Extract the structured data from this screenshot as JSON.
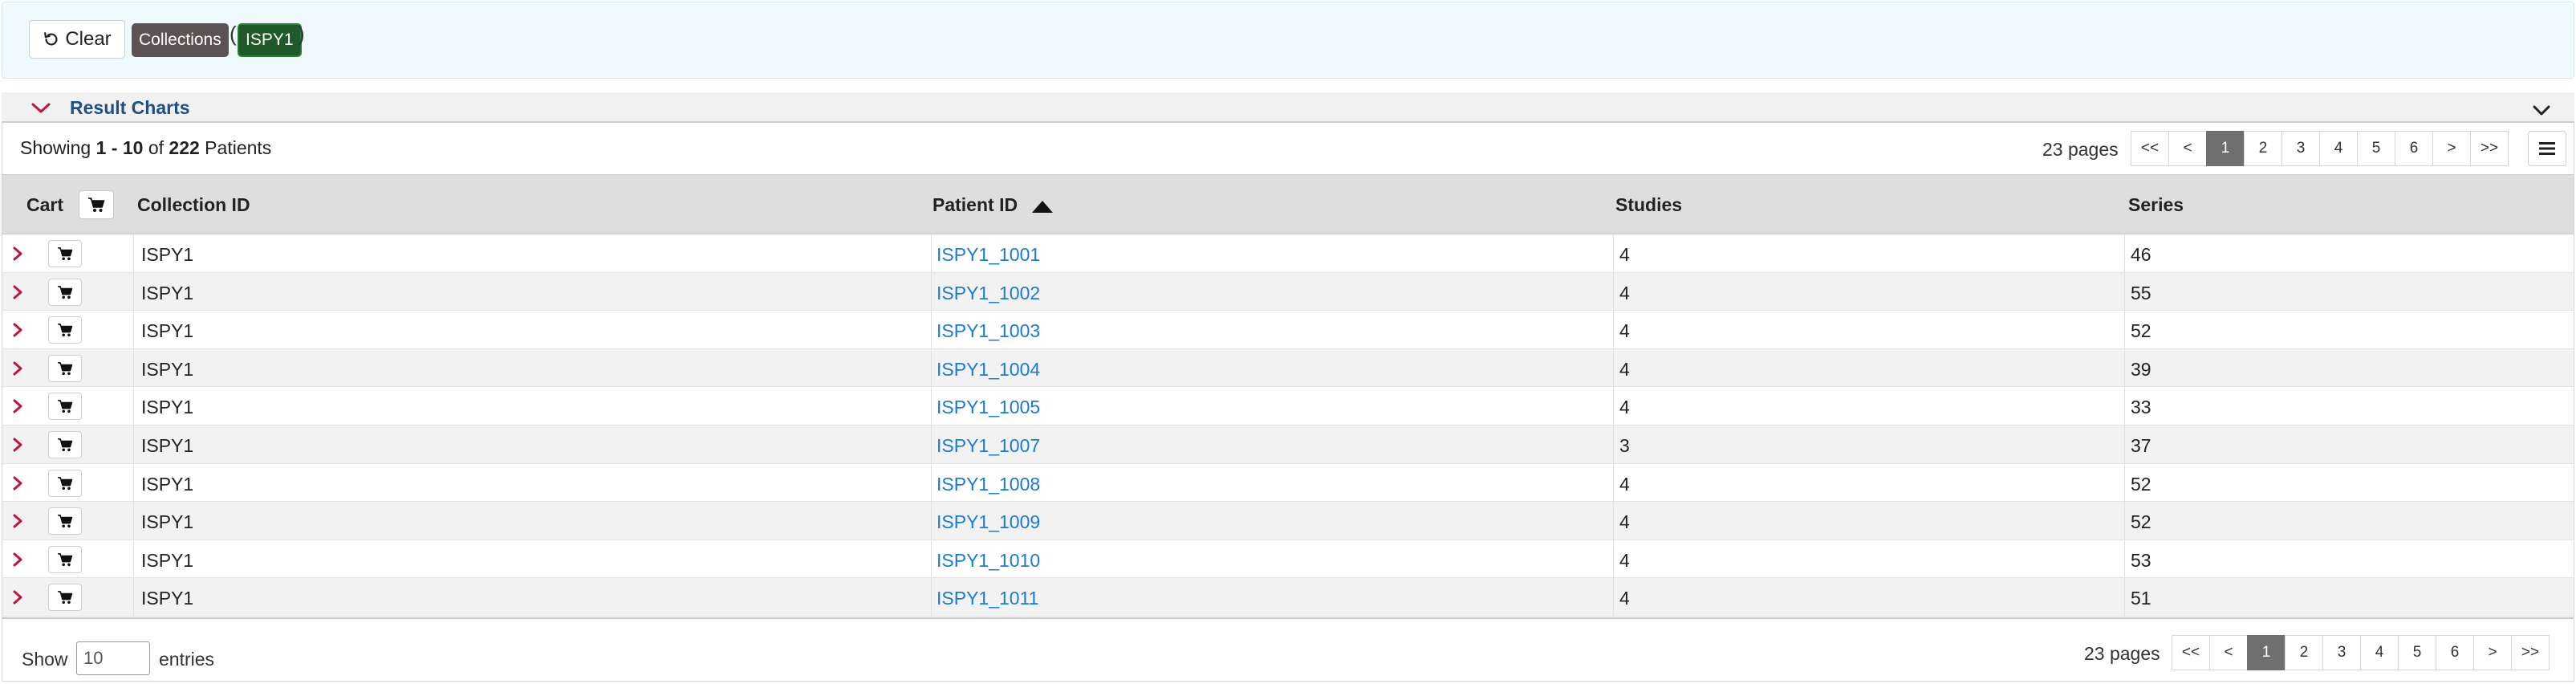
{
  "filter": {
    "clear_label": "Clear",
    "field_label": "Collections",
    "open_paren": "(",
    "value": "ISPY1",
    "close_paren": ")"
  },
  "charts": {
    "title": "Result Charts"
  },
  "summary": {
    "prefix": "Showing ",
    "range": "1 - 10",
    "of": " of ",
    "total": "222",
    "suffix": " Patients"
  },
  "pagination": {
    "pages_text": "23 pages",
    "first": "<<",
    "prev": "<",
    "pages": [
      "1",
      "2",
      "3",
      "4",
      "5",
      "6"
    ],
    "current_page": "1",
    "next": ">",
    "last": ">>"
  },
  "table": {
    "headers": {
      "cart": "Cart",
      "collection": "Collection ID",
      "patient": "Patient ID",
      "studies": "Studies",
      "series": "Series"
    },
    "sorted_column": "Patient ID",
    "sort_direction": "ascending",
    "rows": [
      {
        "collection": "ISPY1",
        "patient": "ISPY1_1001",
        "studies": "4",
        "series": "46"
      },
      {
        "collection": "ISPY1",
        "patient": "ISPY1_1002",
        "studies": "4",
        "series": "55"
      },
      {
        "collection": "ISPY1",
        "patient": "ISPY1_1003",
        "studies": "4",
        "series": "52"
      },
      {
        "collection": "ISPY1",
        "patient": "ISPY1_1004",
        "studies": "4",
        "series": "39"
      },
      {
        "collection": "ISPY1",
        "patient": "ISPY1_1005",
        "studies": "4",
        "series": "33"
      },
      {
        "collection": "ISPY1",
        "patient": "ISPY1_1007",
        "studies": "3",
        "series": "37"
      },
      {
        "collection": "ISPY1",
        "patient": "ISPY1_1008",
        "studies": "4",
        "series": "52"
      },
      {
        "collection": "ISPY1",
        "patient": "ISPY1_1009",
        "studies": "4",
        "series": "52"
      },
      {
        "collection": "ISPY1",
        "patient": "ISPY1_1010",
        "studies": "4",
        "series": "53"
      },
      {
        "collection": "ISPY1",
        "patient": "ISPY1_1011",
        "studies": "4",
        "series": "51"
      }
    ]
  },
  "footer": {
    "show_label": "Show",
    "entries_value": "10",
    "entries_label": "entries"
  },
  "colors": {
    "link": "#1a7bd6",
    "accent_chevron": "#c0143c",
    "filter_bg": "#eefafb",
    "collection_pill": "#5b5353",
    "value_pill": "#1f5a2a",
    "active_page": "#6f6f6f"
  },
  "icons": {
    "clear": "undo-icon",
    "cart": "cart-icon",
    "expand": "chevron-right-icon",
    "charts_toggle": "chevron-down-icon",
    "menu": "hamburger-icon"
  }
}
